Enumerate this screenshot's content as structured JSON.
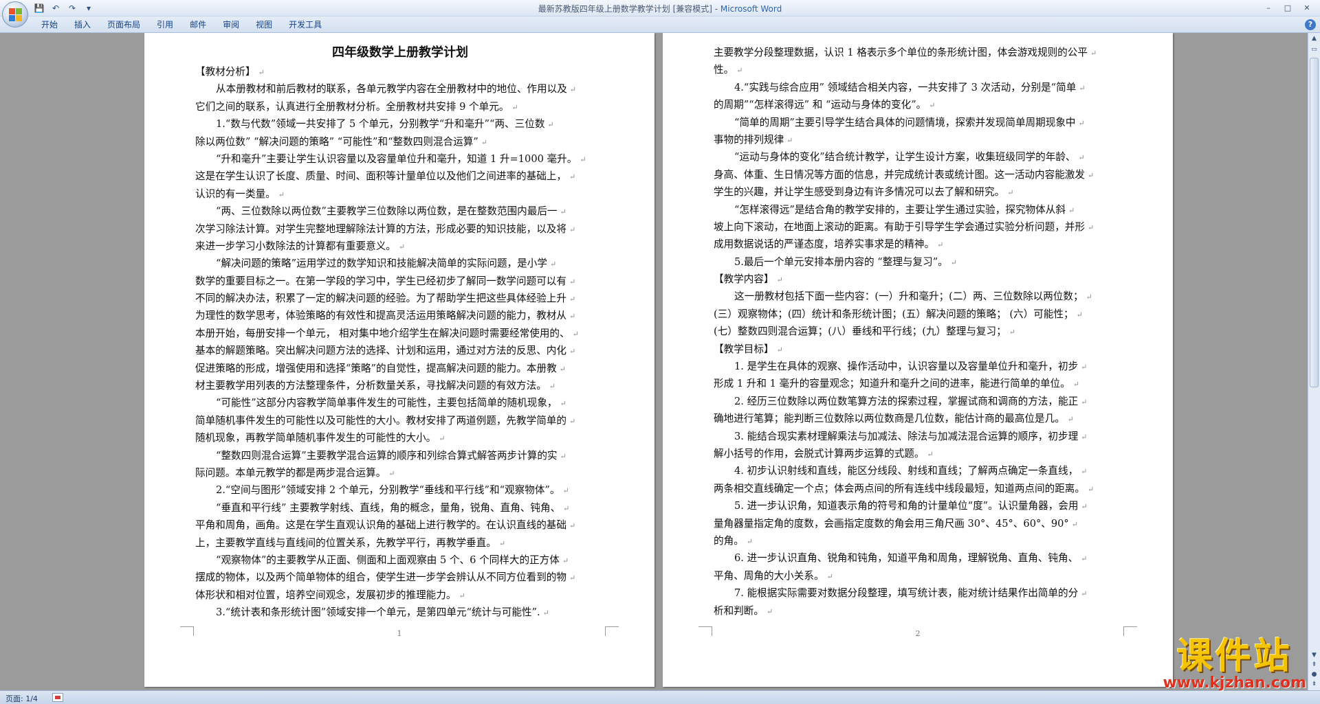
{
  "window": {
    "title_doc": "最新苏教版四年级上册数学教学计划 [兼容模式] -",
    "title_app": " Microsoft Word",
    "minimize": "–",
    "maximize": "□",
    "close": "✕"
  },
  "qat": {
    "save": "💾",
    "undo": "↶",
    "redo": "↷",
    "customize": "▾"
  },
  "tabs": [
    "开始",
    "插入",
    "页面布局",
    "引用",
    "邮件",
    "审阅",
    "视图",
    "开发工具"
  ],
  "help": "?",
  "page1": {
    "title": "四年级数学上册教学计划",
    "number": "1",
    "lines": [
      {
        "t": "【教材分析】",
        "i": false
      },
      {
        "t": "从本册教材和前后教材的联系，各单元教学内容在全册教材中的地位、作用以及",
        "i": true
      },
      {
        "t": "它们之间的联系，认真进行全册教材分析。全册教材共安排 9 个单元。",
        "i": false
      },
      {
        "t": "1.“数与代数”领域一共安排了 5 个单元，分别教学“升和毫升”“两、三位数",
        "i": true
      },
      {
        "t": "除以两位数” “解决问题的策略” “可能性”和“整数四则混合运算”",
        "i": false
      },
      {
        "t": "“升和毫升”主要让学生认识容量以及容量单位升和毫升，知道 1 升=1000 毫升。",
        "i": true
      },
      {
        "t": "这是在学生认识了长度、质量、时间、面积等计量单位以及他们之间进率的基础上，",
        "i": false
      },
      {
        "t": "认识的有一类量。",
        "i": false
      },
      {
        "t": "“两、三位数除以两位数”主要教学三位数除以两位数，是在整数范围内最后一",
        "i": true
      },
      {
        "t": "次学习除法计算。对学生完整地理解除法计算的方法，形成必要的知识技能，以及将",
        "i": false
      },
      {
        "t": "来进一步学习小数除法的计算都有重要意义。",
        "i": false
      },
      {
        "t": "“解决问题的策略”运用学过的数学知识和技能解决简单的实际问题，是小学",
        "i": true
      },
      {
        "t": "数学的重要目标之一。在第一学段的学习中，学生已经初步了解同一数学问题可以有",
        "i": false
      },
      {
        "t": "不同的解决办法，积累了一定的解决问题的经验。为了帮助学生把这些具体经验上升",
        "i": false
      },
      {
        "t": "为理性的数学思考，体验策略的有效性和提高灵活运用策略解决问题的能力，教材从",
        "i": false
      },
      {
        "t": "本册开始，每册安排一个单元， 相对集中地介绍学生在解决问题时需要经常使用的、",
        "i": false
      },
      {
        "t": "基本的解题策略。突出解决问题方法的选择、计划和运用，通过对方法的反思、内化",
        "i": false
      },
      {
        "t": "促进策略的形成，增强使用和选择“策略”的自觉性，提高解决问题的能力。本册教",
        "i": false
      },
      {
        "t": "材主要教学用列表的方法整理条件，分析数量关系，寻找解决问题的有效方法。",
        "i": false
      },
      {
        "t": "“可能性”这部分内容教学简单事件发生的可能性，主要包括简单的随机现象，",
        "i": true
      },
      {
        "t": "简单随机事件发生的可能性以及可能性的大小。教材安排了两道例题，先教学简单的",
        "i": false
      },
      {
        "t": "随机现象，再教学简单随机事件发生的可能性的大小。",
        "i": false
      },
      {
        "t": "“整数四则混合运算”主要教学混合运算的顺序和列综合算式解答两步计算的实",
        "i": true
      },
      {
        "t": "际问题。本单元教学的都是两步混合运算。",
        "i": false
      },
      {
        "t": "2.“空间与图形”领域安排 2 个单元，分别教学“垂线和平行线”和“观察物体”。",
        "i": true
      },
      {
        "t": "“垂直和平行线” 主要教学射线、直线，角的概念，量角，锐角、直角、钝角、",
        "i": true
      },
      {
        "t": "平角和周角，画角。这是在学生直观认识角的基础上进行教学的。在认识直线的基础",
        "i": false
      },
      {
        "t": "上，主要教学直线与直线间的位置关系，先教学平行，再教学垂直。",
        "i": false
      },
      {
        "t": "“观察物体”的主要教学从正面、侧面和上面观察由 5 个、6 个同样大的正方体",
        "i": true
      },
      {
        "t": "摆成的物体，以及两个简单物体的组合，使学生进一步学会辨认从不同方位看到的物",
        "i": false
      },
      {
        "t": "体形状和相对位置，培养空间观念，发展初步的推理能力。",
        "i": false
      },
      {
        "t": "3.“统计表和条形统计图”领域安排一个单元，是第四单元“统计与可能性”.",
        "i": true
      }
    ]
  },
  "page2": {
    "number": "2",
    "lines": [
      {
        "t": "主要教学分段整理数据，认识 1 格表示多个单位的条形统计图，体会游戏规则的公平",
        "i": false
      },
      {
        "t": "性。",
        "i": false
      },
      {
        "t": "4.“实践与综合应用” 领域结合相关内容，一共安排了 3 次活动，分别是“简单",
        "i": true
      },
      {
        "t": "的周期”“怎样滚得远” 和 “运动与身体的变化”。",
        "i": false
      },
      {
        "t": "“简单的周期”主要引导学生结合具体的问题情境，探索并发现简单周期现象中",
        "i": true
      },
      {
        "t": "事物的排列规律",
        "i": false
      },
      {
        "t": "“运动与身体的变化”结合统计教学，让学生设计方案，收集班级同学的年龄、",
        "i": true
      },
      {
        "t": "身高、体重、生日情况等方面的信息，并完成统计表或统计图。这一活动内容能激发",
        "i": false
      },
      {
        "t": "学生的兴趣，并让学生感受到身边有许多情况可以去了解和研究。",
        "i": false
      },
      {
        "t": "“怎样滚得远”是结合角的教学安排的，主要让学生通过实验，探究物体从斜",
        "i": true
      },
      {
        "t": "坡上向下滚动，在地面上滚动的距离。有助于引导学生学会通过实验分析问题，并形",
        "i": false
      },
      {
        "t": "成用数据说话的严谨态度，培养实事求是的精神。",
        "i": false
      },
      {
        "t": "5.最后一个单元安排本册内容的 “整理与复习”。",
        "i": true
      },
      {
        "t": "【教学内容】",
        "i": false
      },
      {
        "t": "这一册教材包括下面一些内容：(一）升和毫升；(二）两、三位数除以两位数；",
        "i": true
      },
      {
        "t": "(三）观察物体；(四）统计和条形统计图；(五）解决问题的策略；  (六）可能性；",
        "i": false
      },
      {
        "t": "(七）整数四则混合运算；(八）垂线和平行线；(九）整理与复习；",
        "i": false
      },
      {
        "t": "【教学目标】",
        "i": false
      },
      {
        "t": "1. 是学生在具体的观察、操作活动中，认识容量以及容量单位升和毫升，初步",
        "i": true
      },
      {
        "t": "形成 1 升和 1 毫升的容量观念；知道升和毫升之间的进率，能进行简单的单位。",
        "i": false
      },
      {
        "t": "2. 经历三位数除以两位数笔算方法的探索过程，掌握试商和调商的方法，能正",
        "i": true
      },
      {
        "t": "确地进行笔算；能判断三位数除以两位数商是几位数，能估计商的最高位是几。",
        "i": false
      },
      {
        "t": "3. 能结合现实素材理解乘法与加减法、除法与加减法混合运算的顺序，初步理",
        "i": true
      },
      {
        "t": "解小括号的作用，会脱式计算两步运算的式题。",
        "i": false
      },
      {
        "t": "4. 初步认识射线和直线，能区分线段、射线和直线；了解两点确定一条直线，",
        "i": true
      },
      {
        "t": "两条相交直线确定一个点；体会两点间的所有连线中线段最短，知道两点间的距离。",
        "i": false
      },
      {
        "t": "5. 进一步认识角，知道表示角的符号和角的计量单位“度”。认识量角器，会用",
        "i": true
      },
      {
        "t": "量角器量指定角的度数，会画指定度数的角会用三角尺画 30°、45°、60°、90°",
        "i": false
      },
      {
        "t": "的角。",
        "i": false
      },
      {
        "t": "6. 进一步认识直角、锐角和钝角，知道平角和周角，理解锐角、直角、钝角、",
        "i": true
      },
      {
        "t": "平角、周角的大小关系。",
        "i": false
      },
      {
        "t": "7. 能根据实际需要对数据分段整理，填写统计表，能对统计结果作出简单的分",
        "i": true
      },
      {
        "t": "析和判断。",
        "i": false
      }
    ]
  },
  "paragraph_mark": "↵",
  "status": {
    "page": "页面: 1/4"
  },
  "watermark": {
    "name": "课件站",
    "url": "www.kjzhan.com"
  },
  "colors": {
    "ribbon_text": "#15428b",
    "app_title": "#2c63b4",
    "doc_bg": "#9b9b9b",
    "watermark_yellow": "#f5c400",
    "watermark_red": "#e03020"
  }
}
